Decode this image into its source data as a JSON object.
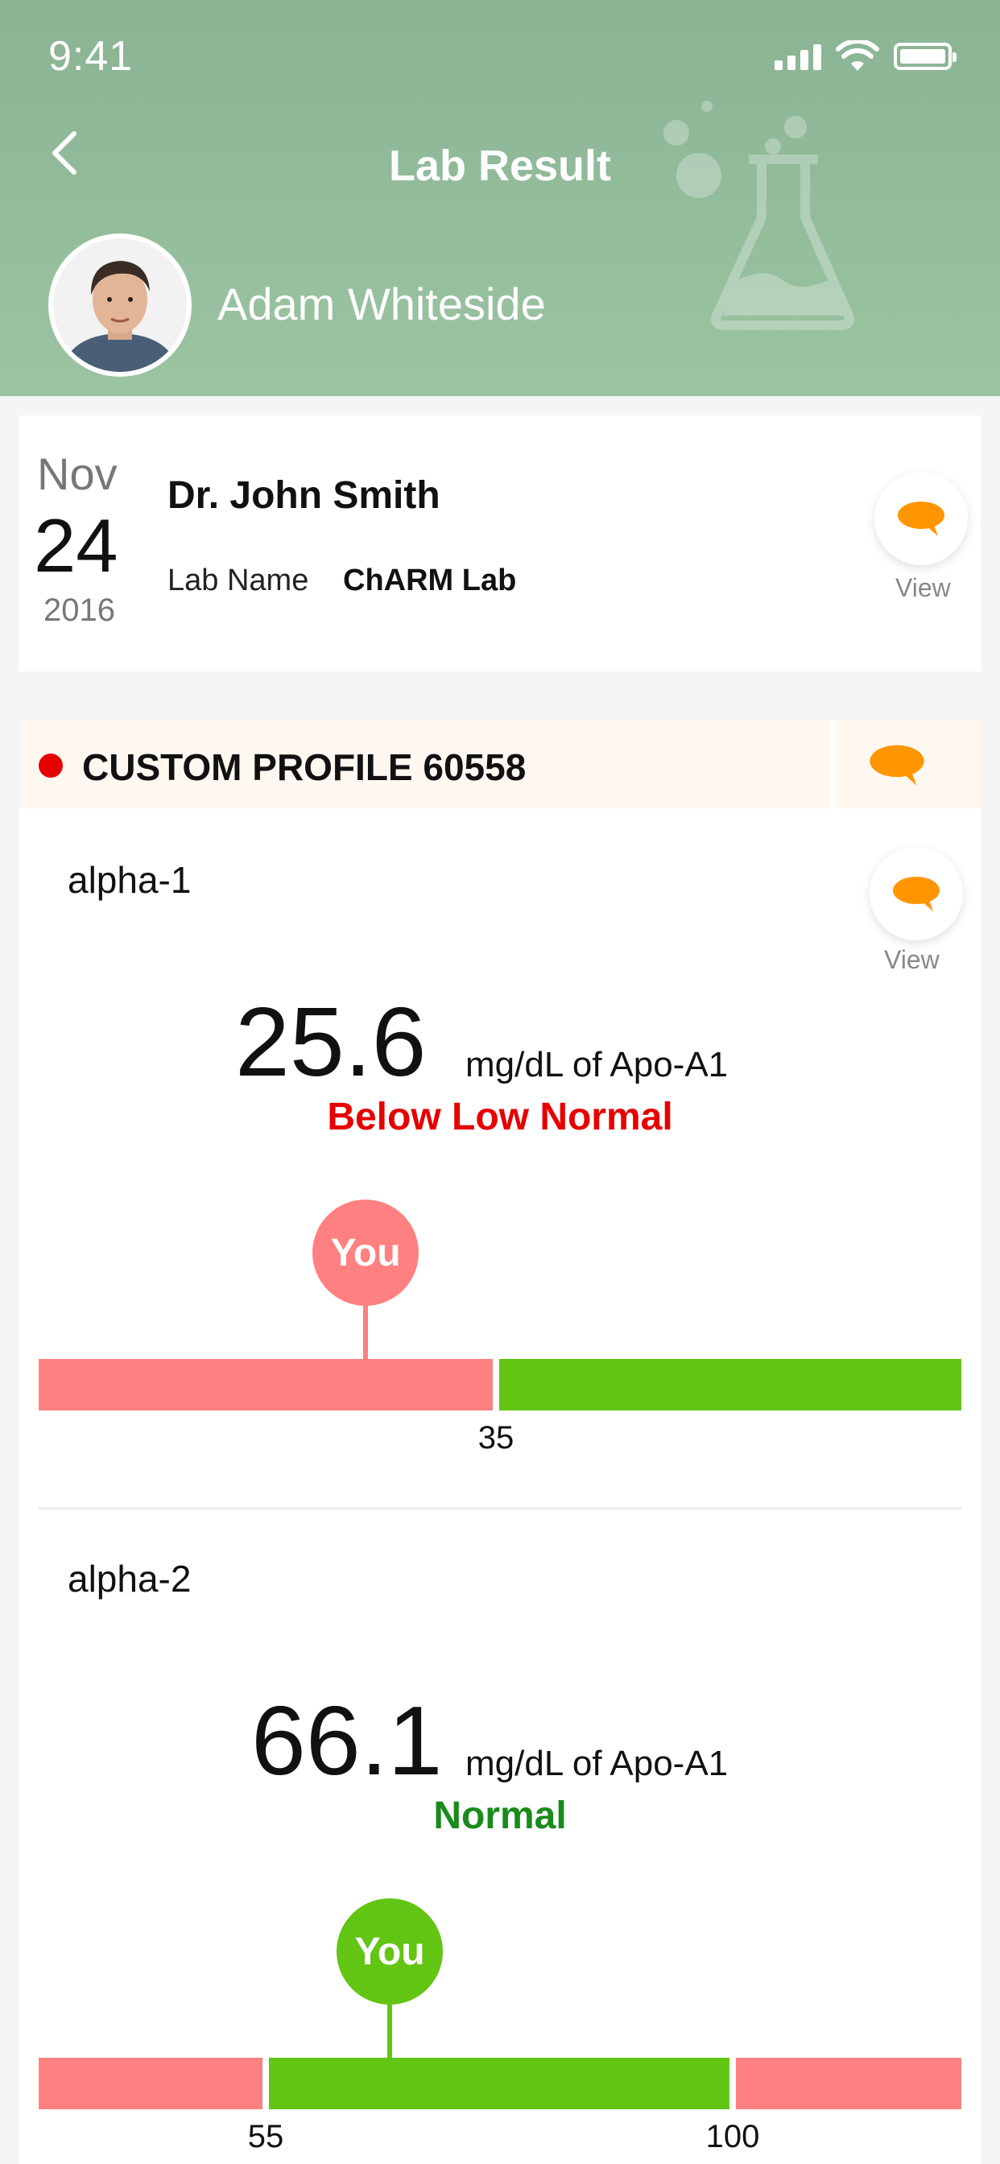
{
  "status_bar": {
    "time": "9:41"
  },
  "header": {
    "title": "Lab Result",
    "patient_name": "Adam Whiteside",
    "background_color": "#8ab394",
    "icons": [
      "back-chevron-icon",
      "flask-icon"
    ]
  },
  "visit": {
    "month": "Nov",
    "day": "24",
    "year": "2016",
    "doctor": "Dr. John Smith",
    "lab_label": "Lab Name",
    "lab_name": "ChARM Lab",
    "view_label": "View"
  },
  "profile": {
    "title": "CUSTOM PROFILE 60558",
    "status_color": "#e60000",
    "tests": [
      {
        "name": "alpha-1",
        "value": "25.6",
        "unit": "mg/dL of Apo-A1",
        "status": "Below Low Normal",
        "status_color": "#e60000",
        "view_label": "View",
        "marker_label": "You",
        "thresholds": [
          "35"
        ],
        "range_colors": [
          "#ff8080",
          "#62c514"
        ]
      },
      {
        "name": "alpha-2",
        "value": "66.1",
        "unit": "mg/dL of Apo-A1",
        "status": "Normal",
        "status_color": "#1a8a1a",
        "marker_label": "You",
        "thresholds": [
          "55",
          "100"
        ],
        "range_colors": [
          "#ff8080",
          "#62c514",
          "#ff8080"
        ]
      }
    ]
  },
  "colors": {
    "low": "#ff8080",
    "normal": "#62c514",
    "comment_icon": "#ff9500"
  }
}
